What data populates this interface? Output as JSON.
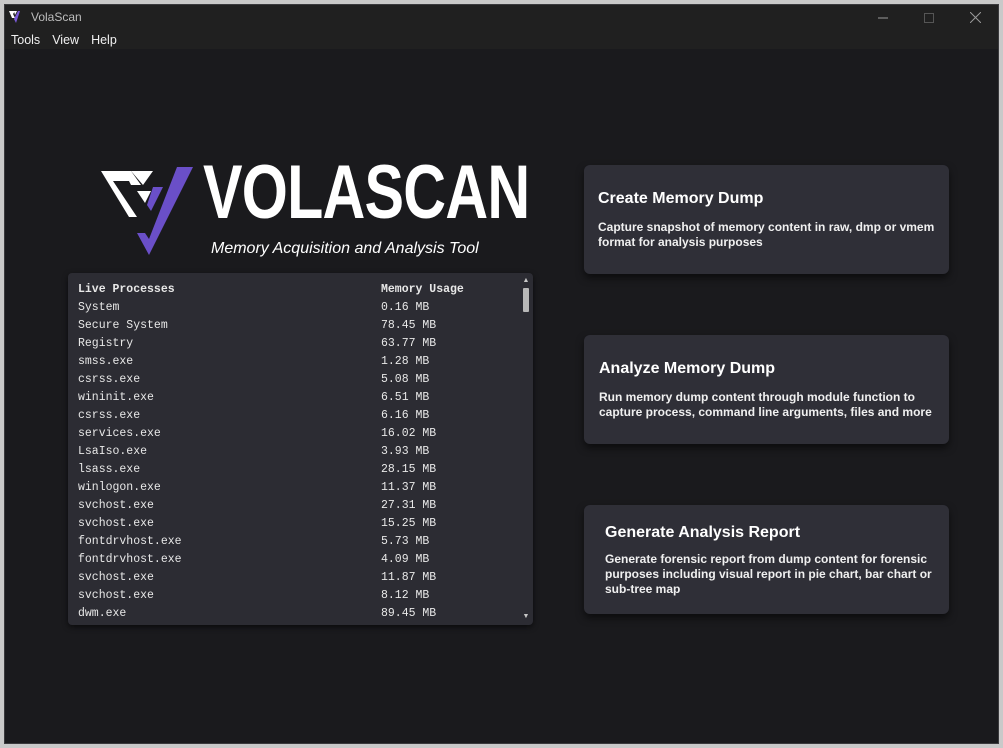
{
  "window": {
    "title": "VolaScan",
    "controls": {
      "minimize_icon": "minimize-icon",
      "maximize_icon": "maximize-icon",
      "close_icon": "close-icon"
    }
  },
  "menu": {
    "items": [
      {
        "label": "Tools"
      },
      {
        "label": "View"
      },
      {
        "label": "Help"
      }
    ]
  },
  "logo": {
    "word": "VOLASCAN",
    "tagline": "Memory Acquisition and Analysis Tool",
    "accent_color": "#6a4fc8"
  },
  "process_list": {
    "headers": {
      "name": "Live Processes",
      "memory": "Memory Usage"
    },
    "rows": [
      {
        "name": "System",
        "memory": "0.16 MB"
      },
      {
        "name": "Secure System",
        "memory": "78.45 MB"
      },
      {
        "name": "Registry",
        "memory": "63.77 MB"
      },
      {
        "name": "smss.exe",
        "memory": "1.28 MB"
      },
      {
        "name": "csrss.exe",
        "memory": "5.08 MB"
      },
      {
        "name": "wininit.exe",
        "memory": "6.51 MB"
      },
      {
        "name": "csrss.exe",
        "memory": "6.16 MB"
      },
      {
        "name": "services.exe",
        "memory": "16.02 MB"
      },
      {
        "name": "LsaIso.exe",
        "memory": "3.93 MB"
      },
      {
        "name": "lsass.exe",
        "memory": "28.15 MB"
      },
      {
        "name": "winlogon.exe",
        "memory": "11.37 MB"
      },
      {
        "name": "svchost.exe",
        "memory": "27.31 MB"
      },
      {
        "name": "svchost.exe",
        "memory": "15.25 MB"
      },
      {
        "name": "fontdrvhost.exe",
        "memory": "5.73 MB"
      },
      {
        "name": "fontdrvhost.exe",
        "memory": "4.09 MB"
      },
      {
        "name": "svchost.exe",
        "memory": "11.87 MB"
      },
      {
        "name": "svchost.exe",
        "memory": "8.12 MB"
      },
      {
        "name": "dwm.exe",
        "memory": "89.45 MB"
      }
    ]
  },
  "cards": [
    {
      "title": "Create Memory Dump",
      "description": "Capture snapshot of memory content in raw, dmp or vmem format for analysis purposes"
    },
    {
      "title": "Analyze Memory Dump",
      "description": "Run memory dump content through module function to capture process, command line arguments, files and more"
    },
    {
      "title": "Generate Analysis Report",
      "description": "Generate forensic report from dump content for forensic purposes including visual report in pie chart, bar chart or sub-tree map"
    }
  ]
}
